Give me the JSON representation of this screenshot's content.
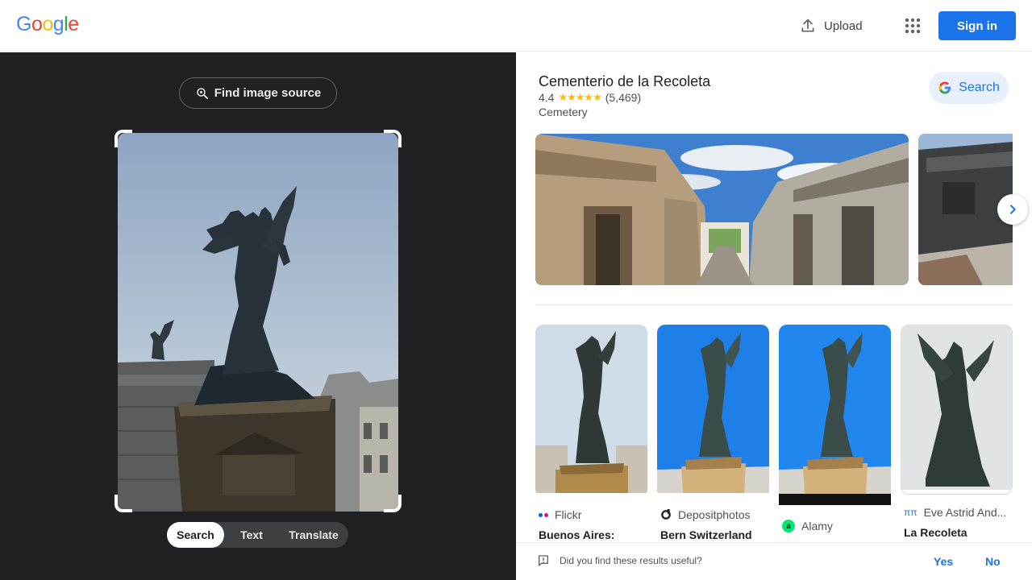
{
  "header": {
    "logo": [
      "G",
      "o",
      "o",
      "g",
      "l",
      "e"
    ],
    "logo_colors": [
      "#4285f4",
      "#ea4335",
      "#fbbc05",
      "#4285f4",
      "#34a853",
      "#ea4335"
    ],
    "upload_label": "Upload",
    "signin_label": "Sign in"
  },
  "left": {
    "find_source_label": "Find image source",
    "tabs": [
      {
        "label": "Search",
        "active": true
      },
      {
        "label": "Text",
        "active": false
      },
      {
        "label": "Translate",
        "active": false
      }
    ]
  },
  "knowledge": {
    "title": "Cementerio de la Recoleta",
    "rating": "4.4",
    "stars": "★★★★★",
    "reviews": "(5,469)",
    "category": "Cemetery",
    "search_label": "Search"
  },
  "results": [
    {
      "source": "Flickr",
      "title": "Buenos Aires:"
    },
    {
      "source": "Depositphotos",
      "title": "Bern Switzerland"
    },
    {
      "source": "Alamy",
      "title": ""
    },
    {
      "source": "Eve Astrid And...",
      "title": "La Recoleta"
    }
  ],
  "feedback": {
    "question": "Did you find these results useful?",
    "yes": "Yes",
    "no": "No"
  },
  "colors": {
    "accent": "#1a73e8",
    "dark_bg": "#202124"
  }
}
